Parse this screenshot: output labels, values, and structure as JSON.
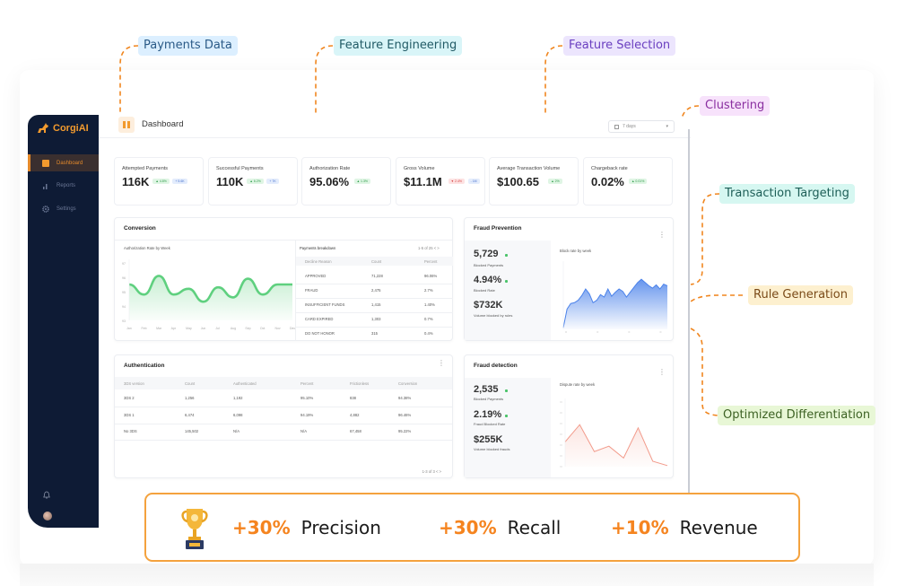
{
  "app": {
    "brand": "CorgiAI",
    "page_title": "Dashboard",
    "date_range": "7 days",
    "colors": {
      "accent": "#f29a2e",
      "sidebar": "#0e1b35",
      "positive": "#2f9c4a",
      "negative": "#d64545",
      "banner_border": "#f4a23e"
    }
  },
  "sidebar": {
    "items": [
      {
        "label": "Dashboard",
        "icon": "dashboard-icon",
        "active": true
      },
      {
        "label": "Reports",
        "icon": "bar-chart-icon",
        "active": false
      },
      {
        "label": "Settings",
        "icon": "gear-icon",
        "active": false
      }
    ],
    "bottom_icons": [
      "bell-icon",
      "avatar"
    ]
  },
  "kpis": [
    {
      "label": "Attempted Payments",
      "value": "116K",
      "badges": [
        {
          "text": "▲ 4.8%",
          "tone": "green"
        },
        {
          "text": "+ 5.6K",
          "tone": "blue"
        }
      ]
    },
    {
      "label": "Successful Payments",
      "value": "110K",
      "badges": [
        {
          "text": "▲ 6.2%",
          "tone": "green"
        },
        {
          "text": "+ 7K",
          "tone": "blue"
        }
      ]
    },
    {
      "label": "Authorization Rate",
      "value": "95.06%",
      "badges": [
        {
          "text": "▲ 1.3%",
          "tone": "green"
        }
      ]
    },
    {
      "label": "Gross Volume",
      "value": "$11.1M",
      "badges": [
        {
          "text": "▼ 2.4%",
          "tone": "red"
        },
        {
          "text": "- 1M",
          "tone": "blue"
        }
      ]
    },
    {
      "label": "Average Transaction Volume",
      "value": "$100.65",
      "badges": [
        {
          "text": "▲ 2%",
          "tone": "green"
        }
      ]
    },
    {
      "label": "Chargeback rate",
      "value": "0.02%",
      "badges": [
        {
          "text": "▲ 0.01%",
          "tone": "green"
        }
      ]
    }
  ],
  "conversion": {
    "title": "Conversion",
    "chart_title": "Authorization Rate by Week",
    "y_ticks": [
      "97",
      "96",
      "95",
      "94",
      "93"
    ],
    "x_ticks": [
      "Jan",
      "Feb",
      "Mar",
      "Apr",
      "May",
      "Jun",
      "Jul",
      "Aug",
      "Sep",
      "Oct",
      "Nov",
      "Dec"
    ],
    "breakdown": {
      "title": "Payments breakdown",
      "pager": "1-5 of 25 < >",
      "columns": [
        "Decline Reason",
        "Count",
        "Percent"
      ],
      "rows": [
        [
          "APPROVED",
          "71,228",
          "96.06%"
        ],
        [
          "FRAUD",
          "2,475",
          "2.7%"
        ],
        [
          "INSUFFICIENT FUNDS",
          "1,415",
          "1.40%"
        ],
        [
          "CARD EXPIRED",
          "1,303",
          "0.7%"
        ],
        [
          "DO NOT HONOR",
          "315",
          "0.4%"
        ]
      ]
    }
  },
  "fraud_prevention": {
    "title": "Fraud Prevention",
    "stats": [
      {
        "value": "5,729",
        "label": "Blocked Payments",
        "up": true
      },
      {
        "value": "4.94%",
        "label": "Blocked Rate",
        "up": true
      },
      {
        "value": "$732K",
        "label": "Volume blocked by rules",
        "up": false
      }
    ],
    "chart_title": "Block rate by week"
  },
  "authentication": {
    "title": "Authentication",
    "columns": [
      "3DS version",
      "Count",
      "Authenticated",
      "Percent",
      "Frictionless",
      "Conversion"
    ],
    "rows": [
      [
        "3DS 2",
        "1,256",
        "1,192",
        "95.10%",
        "838",
        "94.38%"
      ],
      [
        "3DS 1",
        "6,474",
        "6,098",
        "94.19%",
        "4,882",
        "96.46%"
      ],
      [
        "No 3DS",
        "145,502",
        "N/A",
        "N/A",
        "67,458",
        "95.22%"
      ]
    ],
    "pager": "1-3 of 3 < >"
  },
  "fraud_detection": {
    "title": "Fraud detection",
    "stats": [
      {
        "value": "2,535",
        "label": "Blocked Payments",
        "up": true
      },
      {
        "value": "2.19%",
        "label": "Fraud Blocked Rate",
        "up": true
      },
      {
        "value": "$255K",
        "label": "Volume blocked frauds",
        "up": false
      }
    ],
    "chart_title": "Dispute rate by week"
  },
  "pipeline_labels": [
    {
      "text": "Payments Data",
      "bg": "#dcefff",
      "fg": "#2a5a86"
    },
    {
      "text": "Feature Engineering",
      "bg": "#d9f5f8",
      "fg": "#215b66"
    },
    {
      "text": "Feature Selection",
      "bg": "#ece5fd",
      "fg": "#6a3fc0"
    },
    {
      "text": "Clustering",
      "bg": "#f7e2fb",
      "fg": "#8a2fa0"
    },
    {
      "text": "Transaction Targeting",
      "bg": "#d6f7f1",
      "fg": "#1d5e57"
    },
    {
      "text": "Rule Generation",
      "bg": "#fdf0cf",
      "fg": "#7a4a18"
    },
    {
      "text": "Optimized Differentiation",
      "bg": "#e8f7d6",
      "fg": "#3d6224"
    }
  ],
  "results": {
    "icon": "trophy-icon",
    "metrics": [
      {
        "pct": "+30%",
        "name": "Precision"
      },
      {
        "pct": "+30%",
        "name": "Recall"
      },
      {
        "pct": "+10%",
        "name": "Revenue"
      }
    ]
  },
  "chart_data": [
    {
      "type": "area",
      "title": "Authorization Rate by Week",
      "xlabel": "",
      "ylabel": "",
      "x": [
        "Jan",
        "Feb",
        "Mar",
        "Apr",
        "May",
        "Jun",
        "Jul",
        "Aug",
        "Sep",
        "Oct",
        "Nov",
        "Dec"
      ],
      "values": [
        95.5,
        94.8,
        96.1,
        94.8,
        95.2,
        94.3,
        95.3,
        94.6,
        95.9,
        94.8,
        95.5,
        95.5
      ],
      "ylim": [
        93,
        97
      ],
      "grid": false,
      "color": "#5fd07f"
    },
    {
      "type": "area",
      "title": "Block rate by week",
      "values": [
        0.2,
        2.5,
        3.2,
        3.3,
        3.6,
        4.2,
        5.0,
        4.4,
        3.3,
        3.6,
        4.3,
        4.0,
        5.0,
        4.1,
        4.6,
        5.0,
        4.7,
        4.0,
        4.6,
        5.2,
        5.8,
        6.2,
        5.8,
        5.4,
        5.1,
        5.5,
        5.0,
        5.6,
        5.4
      ],
      "ylim": [
        0,
        8
      ],
      "color": "#4b82ea"
    },
    {
      "type": "area",
      "title": "Dispute rate by week",
      "values": [
        2.3,
        3.9,
        1.4,
        1.9,
        0.8,
        3.6,
        0.5,
        0.1
      ],
      "ylim": [
        0,
        6
      ],
      "color": "#f29a8a"
    }
  ]
}
